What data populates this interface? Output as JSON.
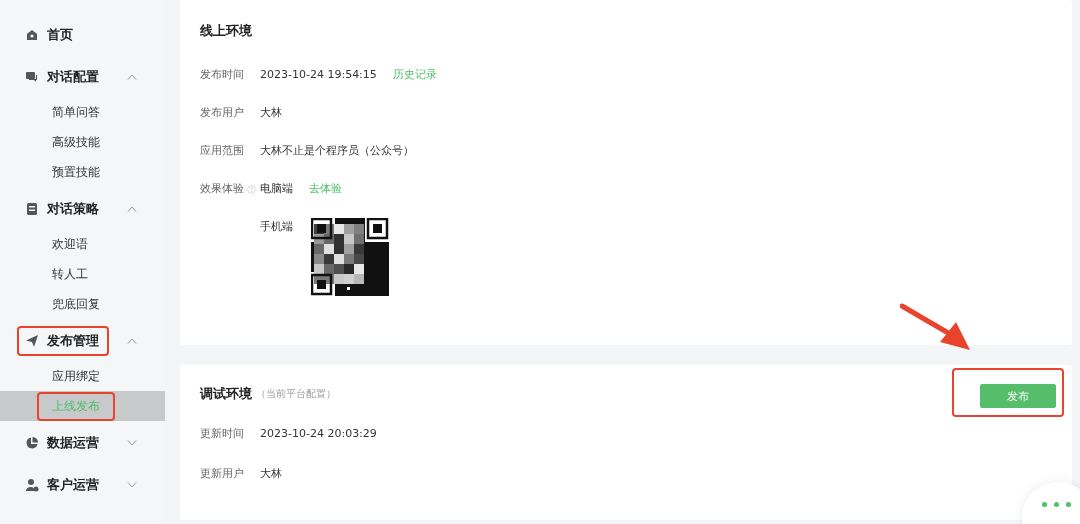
{
  "sidebar": {
    "items": [
      {
        "label": "首页",
        "annotated": false
      },
      {
        "label": "对话配置",
        "annotated": false,
        "expanded": true,
        "children": [
          {
            "label": "简单问答",
            "selected": false,
            "annotated": false
          },
          {
            "label": "高级技能",
            "selected": false,
            "annotated": false
          },
          {
            "label": "预置技能",
            "selected": false,
            "annotated": false
          }
        ]
      },
      {
        "label": "对话策略",
        "annotated": false,
        "expanded": true,
        "children": [
          {
            "label": "欢迎语",
            "selected": false,
            "annotated": false
          },
          {
            "label": "转人工",
            "selected": false,
            "annotated": false
          },
          {
            "label": "兜底回复",
            "selected": false,
            "annotated": false
          }
        ]
      },
      {
        "label": "发布管理",
        "annotated": true,
        "expanded": true,
        "children": [
          {
            "label": "应用绑定",
            "selected": false,
            "annotated": false
          },
          {
            "label": "上线发布",
            "selected": true,
            "annotated": true
          }
        ]
      },
      {
        "label": "数据运营",
        "annotated": false,
        "expanded": false
      },
      {
        "label": "客户运营",
        "annotated": false,
        "expanded": false
      }
    ]
  },
  "online": {
    "title": "线上环境",
    "rows": [
      {
        "label": "发布时间",
        "value": "2023-10-24 19:54:15",
        "link": "历史记录"
      },
      {
        "label": "发布用户",
        "value": "大林"
      },
      {
        "label": "应用范围",
        "value": "大林不止是个程序员（公众号）"
      },
      {
        "label": "效果体验",
        "help": true,
        "value": "电脑端",
        "link": "去体验"
      },
      {
        "value": "手机端",
        "kind": "qr"
      }
    ]
  },
  "debug": {
    "title": "调试环境",
    "subtitle": "（当前平台配置）",
    "button": {
      "label": "发布",
      "annotated": true
    },
    "rows": [
      {
        "label": "更新时间",
        "value": "2023-10-24 20:03:29"
      },
      {
        "label": "更新用户",
        "value": "大林"
      }
    ]
  }
}
